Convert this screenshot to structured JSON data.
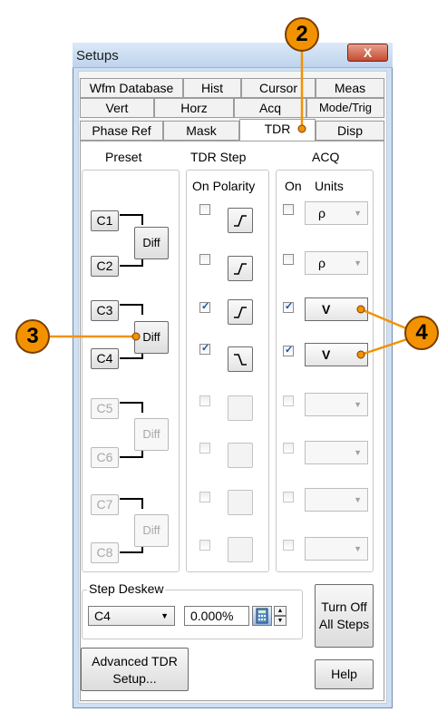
{
  "window": {
    "title": "Setups",
    "close_glyph": "X"
  },
  "tabs": {
    "row1": [
      "Wfm Database",
      "Hist",
      "Cursor",
      "Meas"
    ],
    "row2": [
      "Vert",
      "Horz",
      "Acq",
      "Mode/Trig"
    ],
    "row3": [
      "Phase Ref",
      "Mask",
      "TDR",
      "Disp"
    ],
    "active": "TDR"
  },
  "headers": {
    "preset": "Preset",
    "tdr_step": "TDR Step",
    "acq": "ACQ",
    "on_polarity": "On Polarity",
    "on": "On",
    "units": "Units"
  },
  "channels": [
    {
      "label": "C1",
      "step_on": false,
      "polarity": "rising",
      "acq_on": false,
      "units": "ρ",
      "enabled": true
    },
    {
      "label": "C2",
      "step_on": false,
      "polarity": "rising",
      "acq_on": false,
      "units": "ρ",
      "enabled": true
    },
    {
      "label": "C3",
      "step_on": true,
      "polarity": "rising",
      "acq_on": true,
      "units": "V",
      "enabled": true
    },
    {
      "label": "C4",
      "step_on": true,
      "polarity": "falling",
      "acq_on": true,
      "units": "V",
      "enabled": true
    },
    {
      "label": "C5",
      "step_on": false,
      "polarity": "",
      "acq_on": false,
      "units": "",
      "enabled": false
    },
    {
      "label": "C6",
      "step_on": false,
      "polarity": "",
      "acq_on": false,
      "units": "",
      "enabled": false
    },
    {
      "label": "C7",
      "step_on": false,
      "polarity": "",
      "acq_on": false,
      "units": "",
      "enabled": false
    },
    {
      "label": "C8",
      "step_on": false,
      "polarity": "",
      "acq_on": false,
      "units": "",
      "enabled": false
    }
  ],
  "diff_label": "Diff",
  "deskew": {
    "legend": "Step Deskew",
    "channel": "C4",
    "value": "0.000%"
  },
  "buttons": {
    "turn_off": [
      "Turn Off",
      "All Steps"
    ],
    "advanced": [
      "Advanced TDR",
      "Setup..."
    ],
    "help": "Help"
  },
  "callouts": {
    "c2": "2",
    "c3": "3",
    "c4": "4"
  },
  "colors": {
    "callout": "#f39200",
    "window_frame": "#cfe0f3"
  }
}
